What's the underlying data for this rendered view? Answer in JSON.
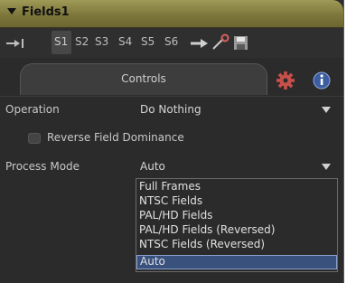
{
  "header": {
    "title": "Fields1",
    "accent_color": "#8c863f"
  },
  "toolbar": {
    "slots": [
      "S1",
      "S2",
      "S3",
      "S4",
      "S5",
      "S6"
    ],
    "selected_slot": "S1"
  },
  "tabs": {
    "controls_label": "Controls"
  },
  "operation": {
    "label": "Operation",
    "value": "Do Nothing"
  },
  "reverse_field": {
    "label": "Reverse Field Dominance",
    "checked": false
  },
  "process_mode": {
    "label": "Process Mode",
    "value": "Auto",
    "options": [
      "Full Frames",
      "NTSC Fields",
      "PAL/HD Fields",
      "PAL/HD Fields (Reversed)",
      "NTSC Fields (Reversed)",
      "Auto"
    ],
    "selected_index": 5,
    "highlight_color": "#39517d"
  }
}
